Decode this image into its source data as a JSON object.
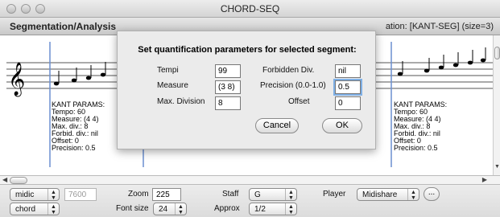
{
  "window": {
    "title": "CHORD-SEQ"
  },
  "header": {
    "left_title": "Segmentation/Analysis",
    "right_info": "ation:  [KANT-SEG] (size=3)"
  },
  "score": {
    "left_params": {
      "title": "KANT PARAMS:",
      "lines": [
        "Tempo: 60",
        "Measure: (4 4)",
        "Max. div.: 8",
        "Forbid. div.: nil",
        "Offset: 0",
        "Precision: 0.5"
      ]
    },
    "right_params": {
      "title": "KANT PARAMS:",
      "lines": [
        "Tempo: 60",
        "Measure: (4 4)",
        "Max. div.: 8",
        "Forbid. div.: nil",
        "Offset: 0",
        "Precision: 0.5"
      ]
    },
    "segment_line_color": "#6b8fd1"
  },
  "dialog": {
    "title": "Set quantification parameters for selected segment:",
    "tempi_label": "Tempi",
    "tempi_value": "99",
    "measure_label": "Measure",
    "measure_value": "(3 8)",
    "maxdiv_label": "Max. Division",
    "maxdiv_value": "8",
    "forbidden_label": "Forbidden Div.",
    "forbidden_value": "nil",
    "precision_label": "Precision (0.0-1.0)",
    "precision_value": "0.5",
    "offset_label": "Offset",
    "offset_value": "0",
    "cancel_label": "Cancel",
    "ok_label": "OK"
  },
  "controls": {
    "mode_select": "midic",
    "mode_value": "7600",
    "view_select": "chord",
    "zoom_label": "Zoom",
    "zoom_value": "225",
    "fontsize_label": "Font size",
    "fontsize_value": "24",
    "staff_label": "Staff",
    "staff_value": "G",
    "approx_label": "Approx",
    "approx_value": "1/2",
    "player_label": "Player",
    "player_value": "Midishare",
    "more_button": "..."
  },
  "icons": [
    "close-icon",
    "minimize-icon",
    "zoom-icon",
    "treble-clef-icon",
    "chevron-updown-icon"
  ]
}
